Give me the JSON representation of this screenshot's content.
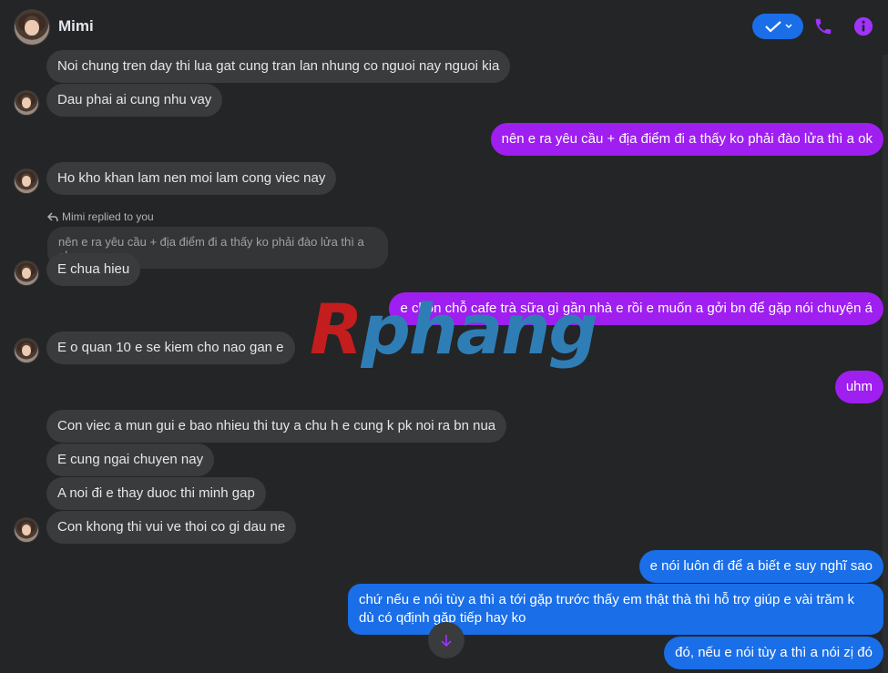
{
  "header": {
    "name": "Mimi"
  },
  "icons": {
    "check": "check-icon",
    "phone": "phone-icon",
    "info": "info-icon",
    "reply": "reply-arrow-icon",
    "scroll_down": "arrow-down-icon"
  },
  "colors": {
    "background": "#242526",
    "incoming": "#3a3b3c",
    "outgoing_purple": "#9f1ef0",
    "outgoing_blue": "#1a6ee8",
    "accent_icons": "#a033ff"
  },
  "messages": {
    "m1": "Noi chung tren day thi lua gat cung tran lan nhung co nguoi nay nguoi kia",
    "m2": "Dau phai ai cung nhu vay",
    "m3": "nên e ra yêu cầu + địa điểm đi a thấy ko phải đào lửa thì a ok",
    "m4": "Ho kho khan lam nen moi lam cong viec nay",
    "reply_label": "Mimi replied to you",
    "quoted": "nên e ra yêu cầu + địa điểm đi a thấy ko phải đào lửa thì a ok",
    "m5": "E chua hieu",
    "m6": "e chọn chỗ cafe trà sữa gì gần nhà e rồi e muốn a gởi bn để gặp nói chuyện á",
    "m7": "E o quan 10 e se kiem cho nao gan e",
    "m8": "uhm",
    "m9": "Con viec a mun gui e bao nhieu thi tuy a chu h e cung k pk noi ra bn nua",
    "m10": "E cung ngai chuyen nay",
    "m11": "A noi đi e thay duoc thi minh gap",
    "m12": "Con khong thi vui ve thoi co gi dau ne",
    "m13": "e nói luôn đi để a biết e suy nghĩ sao",
    "m14_line1": "chứ nếu e nói tùy a thì a tới gặp trước thấy em thật thà thì hỗ trợ giúp e vài trăm k",
    "m14_line2": "dù có qđịnh gặp tiếp hay ko",
    "m15": "đó, nếu e nói tùy a thì a nói zị đó"
  },
  "watermark": {
    "first": "R",
    "rest": "phang"
  }
}
